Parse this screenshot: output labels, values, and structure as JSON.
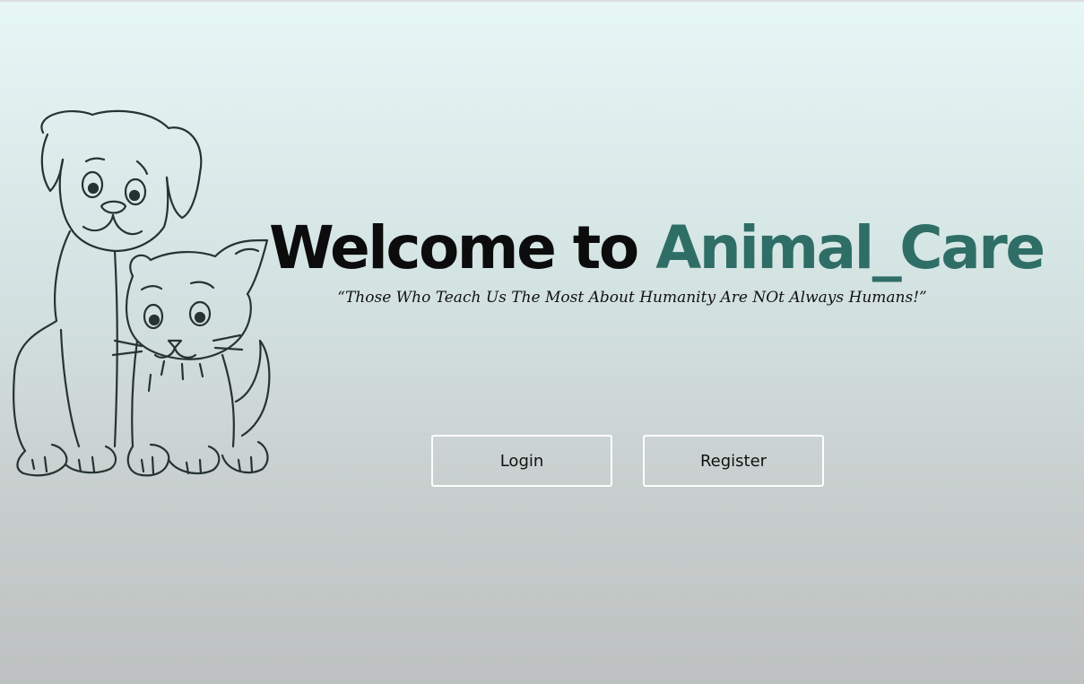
{
  "hero": {
    "title_prefix": "Welcome to ",
    "title_brand": "Animal_Care",
    "tagline": "“Those Who Teach Us The Most About Humanity Are NOt Always Humans!”",
    "illustration": "puppy-and-kitten-line-drawing"
  },
  "actions": {
    "login_label": "Login",
    "register_label": "Register"
  },
  "colors": {
    "brand": "#2f6e66",
    "title": "#0c0c0c",
    "button_border": "#ffffff",
    "background_top": "#e6f7f6",
    "background_bottom": "#bdc1c1"
  }
}
